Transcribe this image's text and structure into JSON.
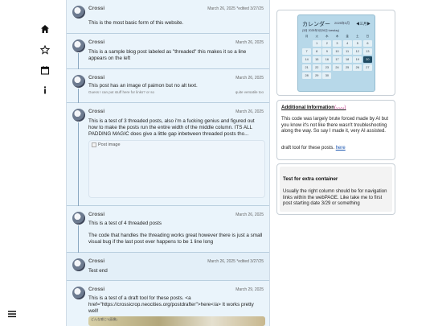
{
  "nav": {
    "items": [
      {
        "icon": "home-icon"
      },
      {
        "icon": "star-icon"
      },
      {
        "icon": "calendar-icon"
      },
      {
        "icon": "info-icon"
      }
    ],
    "menu_icon": "menu-icon"
  },
  "posts": [
    {
      "name": "Crossi",
      "date": "March 26, 2025 *edited 3/27/25",
      "text": "This is the most basic form of this website."
    },
    {
      "name": "Crossi",
      "date": "March 26, 2025",
      "text": "This is a sample blog post labeled as \"threaded\" this makes it so a line appears on the left"
    },
    {
      "name": "Crossi",
      "date": "March 26, 2025",
      "text": "This post has an image of paimon but no alt text.",
      "small_left": "Guess I can put stuff here for links? or so",
      "small_right": "quite versatile too"
    },
    {
      "name": "Crossi",
      "date": "March 26, 2025",
      "text": "This is a test of 3 threaded posts, also i'm a fucking genius and figured out how to make the posts run the entire width of the middle column. ITS ALL PADDING MAGIC does give a little gap inbetween threaded posts tho...",
      "image_alt": "Post image"
    },
    {
      "name": "Crossi",
      "date": "March 26, 2025",
      "text": "This is a test of 4 threaded posts",
      "text2": "The code that handles the threading works great however there is just a small visual bug if the last post ever happens to be 1 line long"
    },
    {
      "name": "Crossi",
      "date": "March 26, 2025 *edited 3/27/25",
      "text": "Test end"
    },
    {
      "name": "Crossi",
      "date": "March 29, 2025",
      "text": "This is a test of a draft tool for these posts. <a href=\"https://crossicrop.neocities.org/postdrafter\">here</a> It works pretty well!",
      "preview_text": "どんな感じ?(画像)"
    }
  ],
  "calendar": {
    "title": "カレンダー",
    "year": "2025年3月",
    "month": "◀三月▶",
    "subtitle": "(3月 2025年3月26日 tuesday)",
    "weekdays": [
      "月",
      "火",
      "水",
      "木",
      "金",
      "土",
      "日"
    ],
    "days": [
      "",
      "1",
      "2",
      "3",
      "4",
      "5",
      "6",
      "7",
      "8",
      "9",
      "10",
      "11",
      "12",
      "13",
      "14",
      "15",
      "16",
      "17",
      "18",
      "19",
      "20",
      "21",
      "22",
      "23",
      "24",
      "25",
      "26",
      "27",
      "28",
      "29",
      "30"
    ],
    "today": "20"
  },
  "info": {
    "title": "Additional Information",
    "title_suffix": "(ᴗᴗᴗ)",
    "text1": "This code was largely brute forced made by AI but you know it's not like there wasn't troubleshooting along the way. So say I made it, very AI assisted.",
    "text2_prefix": "draft tool for these posts. ",
    "link": "here"
  },
  "test": {
    "title": "Test for extra container",
    "text": "Usually the right column should be for navigation links within the webPAGE. Like take me to first post starting date 3/29 or something"
  }
}
